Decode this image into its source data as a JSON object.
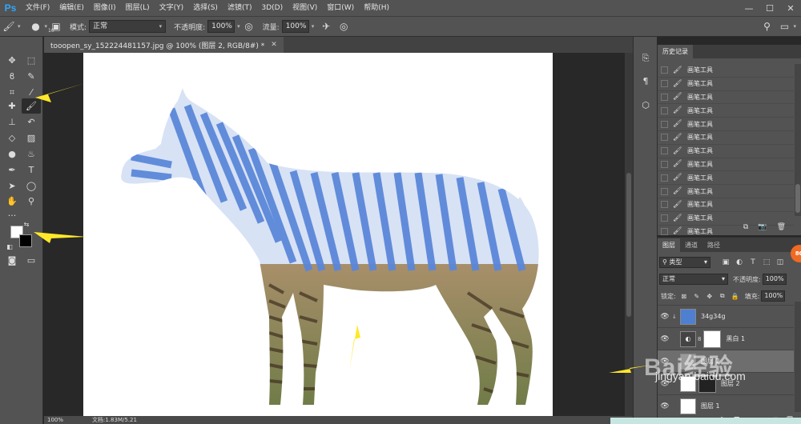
{
  "app": {
    "logo": "Ps"
  },
  "menu": [
    "文件(F)",
    "编辑(E)",
    "图像(I)",
    "图层(L)",
    "文字(Y)",
    "选择(S)",
    "滤镜(T)",
    "3D(D)",
    "视图(V)",
    "窗口(W)",
    "帮助(H)"
  ],
  "window_controls": {
    "minimize": "—",
    "maximize": "☐",
    "close": "✕"
  },
  "options": {
    "brush_size": "10",
    "mode_label": "模式:",
    "mode_value": "正常",
    "opacity_label": "不透明度:",
    "opacity_value": "100%",
    "flow_label": "流量:",
    "flow_value": "100%"
  },
  "document": {
    "tab_title": "tooopen_sy_152224481157.jpg @ 100% (图层 2, RGB/8#) *",
    "zoom": "100%",
    "doc_size": "文档:1.83M/5.21"
  },
  "history": {
    "tabs": [
      "历史记录"
    ],
    "items": [
      "画笔工具",
      "画笔工具",
      "画笔工具",
      "画笔工具",
      "画笔工具",
      "画笔工具",
      "画笔工具",
      "画笔工具",
      "画笔工具",
      "画笔工具",
      "画笔工具",
      "画笔工具",
      "画笔工具",
      "画笔工具"
    ],
    "selected_index": 13
  },
  "layers": {
    "tabs": [
      "图层",
      "通道",
      "路径"
    ],
    "filter_kind": "类型",
    "blend_mode": "正常",
    "opacity_label": "不透明度:",
    "opacity_value": "100%",
    "lock_label": "锁定:",
    "fill_label": "填充:",
    "fill_value": "100%",
    "items": [
      {
        "name": "34g34g",
        "thumb_color": "#4f7fd1"
      },
      {
        "name": "黑白 1",
        "thumb_color": "#ffffff"
      },
      {
        "name": "图层 2",
        "thumb_color": "#9a9a9a"
      },
      {
        "name": "图层 2",
        "thumb_color": "#222222"
      },
      {
        "name": "图层 1",
        "thumb_color": "#ffffff"
      }
    ]
  },
  "colors": {
    "foreground": "#ffffff",
    "background": "#000000",
    "zebra_stripe": "#5b87d9",
    "annotation": "#ffe82a"
  },
  "watermark": {
    "logo": "Bai",
    "word": "经验",
    "url": "jingyan.baidu.com"
  },
  "badge": "8G"
}
